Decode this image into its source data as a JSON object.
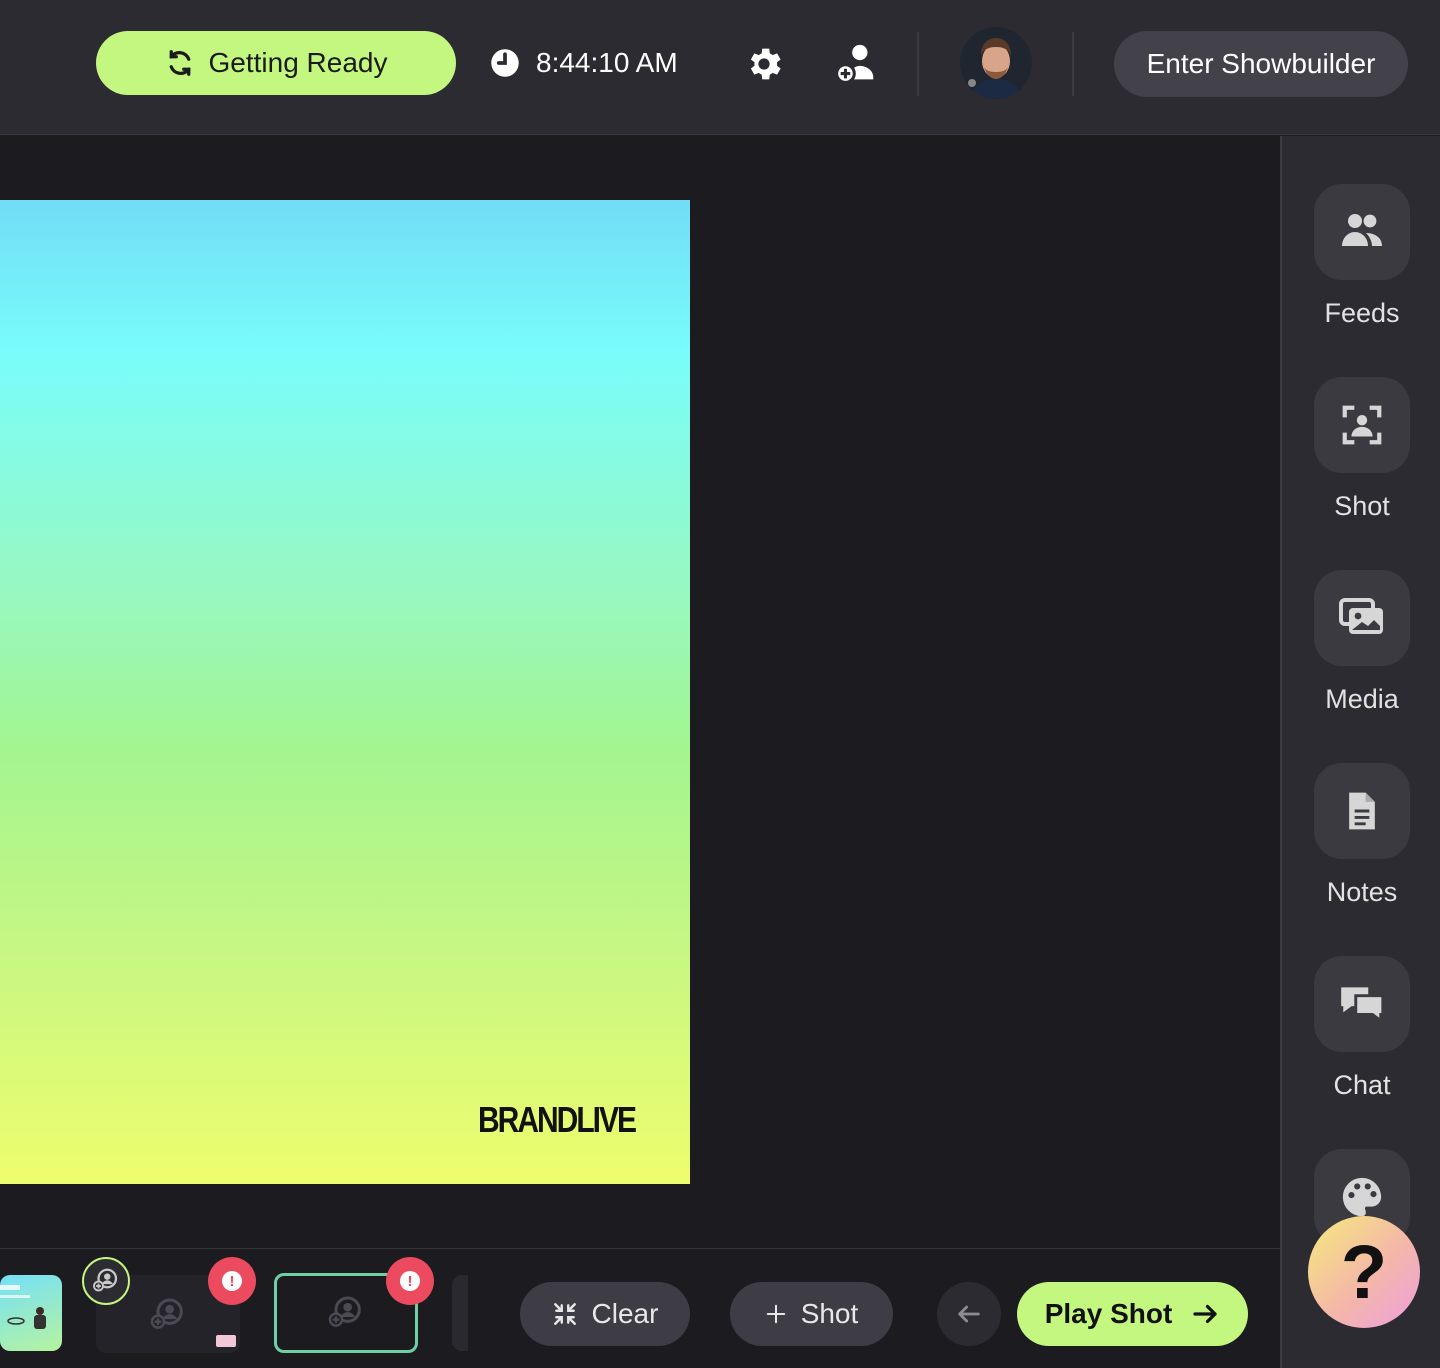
{
  "header": {
    "status_label": "Getting Ready",
    "clock_time": "8:44:10 AM",
    "enter_showbuilder_label": "Enter Showbuilder"
  },
  "stage": {
    "brand_text": "BRANDLIVE"
  },
  "sidebar": {
    "items": [
      {
        "label": "Feeds",
        "icon": "people-icon"
      },
      {
        "label": "Shot",
        "icon": "shot-frame-icon"
      },
      {
        "label": "Media",
        "icon": "images-icon"
      },
      {
        "label": "Notes",
        "icon": "document-icon"
      },
      {
        "label": "Chat",
        "icon": "chat-bubbles-icon"
      },
      {
        "label": "",
        "icon": "palette-icon"
      }
    ]
  },
  "help": {
    "label": "?"
  },
  "bottom": {
    "warning_mark": "!",
    "clear_label": "Clear",
    "add_shot_label": "Shot",
    "play_shot_label": "Play Shot"
  },
  "colors": {
    "accent_green": "#c4f77f",
    "warning_red": "#ec4a5f",
    "panel_bg": "#2c2b32",
    "canvas_bg": "#1c1b20"
  }
}
